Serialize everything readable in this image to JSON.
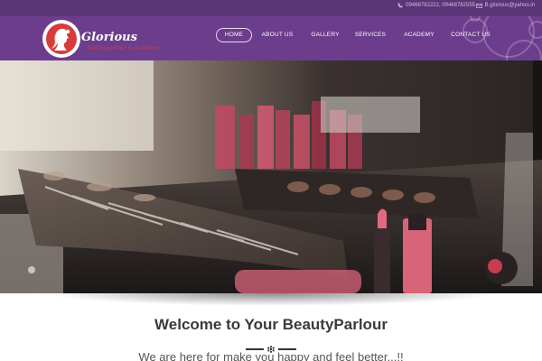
{
  "topbar": {
    "phone": "09468782222, 09468782555",
    "email": "B.glorious@yahoo.in"
  },
  "logo": {
    "title": "Glorious",
    "subtitle": "Beautyparlour & Academy"
  },
  "nav": {
    "items": [
      {
        "label": "HOME",
        "active": true
      },
      {
        "label": "ABOUT US"
      },
      {
        "label": "GALLERY"
      },
      {
        "label": "SERVICES"
      },
      {
        "label": "ACADEMY"
      },
      {
        "label": "CONTACT US"
      }
    ]
  },
  "hero": {
    "image": "makeup-brushes-and-lipsticks-photo"
  },
  "welcome": {
    "title": "Welcome to Your BeautyParlour",
    "tagline": "We are here for make you happy and feel better...!!"
  },
  "colors": {
    "topbar": "#5b3578",
    "header": "#6c3d8c",
    "accent_red": "#d63c3c"
  }
}
